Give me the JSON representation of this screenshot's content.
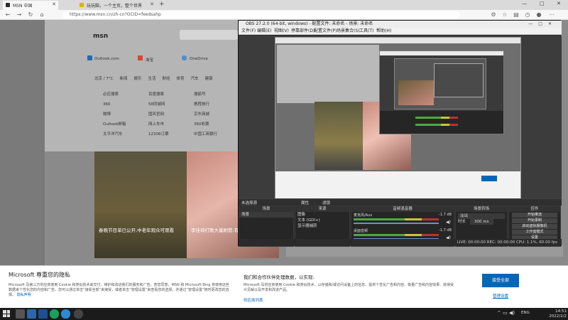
{
  "browser": {
    "tabs": [
      {
        "title": "MSN 中国",
        "color": "#2b2b2b"
      },
      {
        "title": "玩玩脑，一个主页，整个世界",
        "color": "#e0b000"
      }
    ],
    "new_tab": "+",
    "url": "https://www.msn.cn/zh-cn?OCID=feedsahp",
    "window_controls": [
      "—",
      "□",
      "✕"
    ]
  },
  "msn": {
    "logo": "msn",
    "quick_links": [
      "Outlook.com",
      "淘宝",
      "OneDrive"
    ],
    "categories": [
      "北京 / 7°C",
      "新闻",
      "娱乐",
      "生活",
      "财经",
      "体育",
      "汽车",
      "健康"
    ],
    "links": [
      [
        "必应搜索",
        "百度搜索",
        "搜狐号"
      ],
      [
        "360",
        "58同城网",
        "携程旅行"
      ],
      [
        "微博",
        "国风官网",
        "京东商城"
      ],
      [
        "Outlook邮箱",
        "网上车市",
        "360彩票"
      ],
      [
        "太平洋汽车",
        "12306订票",
        "中国工商银行"
      ]
    ],
    "headline1": "春晚节目单已公开,中老年观众可观看",
    "headline2": "李佳琦打歌大量刷赞,有网友爆料"
  },
  "obs": {
    "title": "OBS 27.2.0 (64-bit, windows) - 配置文件: 未命名 - 场景: 未命名",
    "menu": [
      "文件(F)",
      "编辑(E)",
      "视图(V)",
      "停靠部件(D)",
      "配置文件(P)",
      "场景集合(S)",
      "工具(T)",
      "帮助(H)"
    ],
    "no_source": "未选择源",
    "props_label": "属性",
    "filters_label": "滤镜",
    "docks": {
      "scenes": {
        "title": "场景",
        "items": [
          "场景"
        ]
      },
      "sources": {
        "title": "来源",
        "items": [
          "图像",
          "文本 (GDI+)",
          "显示器捕获"
        ]
      },
      "mixer": {
        "title": "音频混音器",
        "items": [
          {
            "name": "麦克风/Aux",
            "db": "-1.7 dB"
          },
          {
            "name": "桌面音频",
            "db": "-1.7 dB"
          }
        ]
      },
      "transitions": {
        "title": "场景转场",
        "fade": "淡出",
        "duration_label": "时长",
        "duration": "300 ms"
      },
      "controls": {
        "title": "控件",
        "buttons": [
          "开始推流",
          "开始录制",
          "启动虚拟摄像机",
          "工作室模式",
          "设置",
          "退出"
        ]
      }
    },
    "status": "LIVE: 00:00:00    REC: 00:00:00    CPU: 1.1%, 60.00 fps"
  },
  "privacy": {
    "title": "Microsoft 尊重您的隐私",
    "body": "Microsoft 及第三方供应商使用 Cookie 和类似技术来交付、维护和改进我们的服务和广告。若您同意，MSN 和 Microsoft Bing 将使用这些数据来个性化您的内容和广告。您可以通过单击“接受全部”来接受，或者单击“管理设置”来查看您的选择，并通过“管理设置”随时更改您的选择。",
    "more": "隐私声明",
    "title2": "我们和合作伙伴处理数据，以实现:",
    "body2": "Microsoft 及供应商使用 Cookie 和类似技术，以存储和/或访问设备上的信息、提供个性化广告和内容、衡量广告和内容效果、获得受众见解以及开发和改进产品。",
    "link2": "供应商列表",
    "accept": "接受全部",
    "manage": "管理设置"
  },
  "taskbar": {
    "ime": "ENG",
    "time": "14:51",
    "date": "2022/2/2"
  }
}
